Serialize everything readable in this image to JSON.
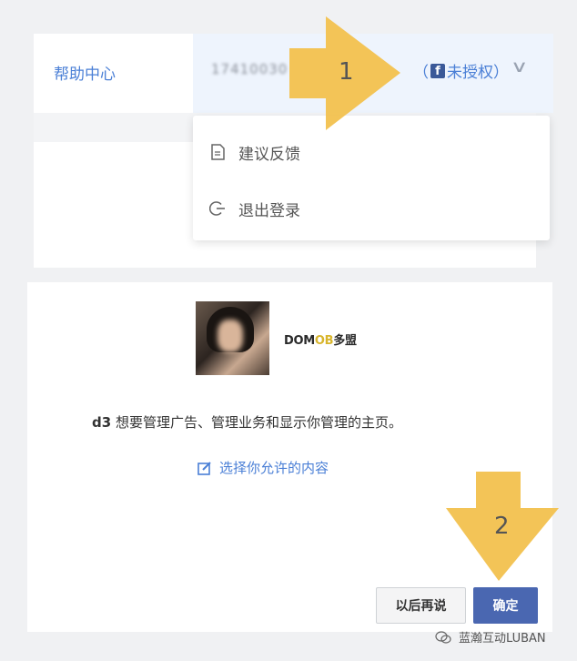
{
  "topbar": {
    "help_label": "帮助中心",
    "account_id": "17410030",
    "fb_paren_open": "（",
    "fb_icon": "f",
    "fb_status": "未授权）",
    "chevron": "∨"
  },
  "dropdown": {
    "items": [
      {
        "icon": "document-icon",
        "label": "建议反馈"
      },
      {
        "icon": "logout-icon",
        "label": "退出登录"
      }
    ]
  },
  "dialog": {
    "brand_prefix": "DOM",
    "brand_o": "O",
    "brand_b": "B",
    "brand_cn": "多盟",
    "app_name": "d3",
    "permission_text": " 想要管理广告、管理业务和显示你管理的主页。",
    "choose_link": "选择你允许的内容",
    "later_button": "以后再说",
    "ok_button": "确定"
  },
  "annotations": {
    "arrow1_label": "1",
    "arrow2_label": "2",
    "arrow_color": "#f2c14e"
  },
  "watermark": {
    "text": "蓝瀚互动LUBAN"
  }
}
